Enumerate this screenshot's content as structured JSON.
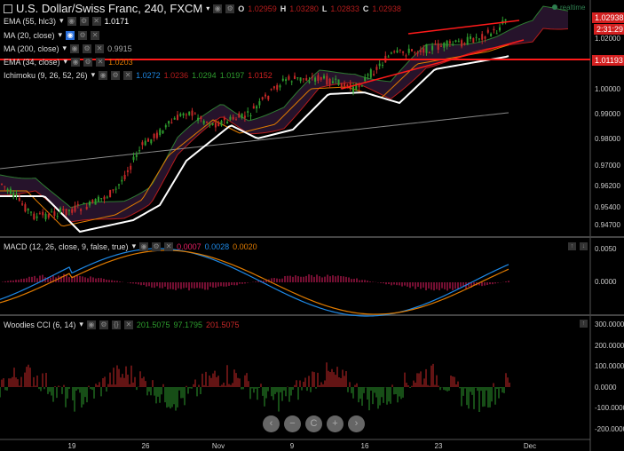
{
  "header": {
    "symbol": "U.S. Dollar/Swiss Franc, 240, FXCM",
    "o_label": "O",
    "o": "1.02959",
    "h_label": "H",
    "h": "1.03280",
    "l_label": "L",
    "l": "1.02833",
    "c_label": "C",
    "c": "1.02938",
    "realtime": "realtime"
  },
  "indicators": [
    {
      "label": "EMA (55, hlc3)",
      "value": "1.0171",
      "color": "#ffffff"
    },
    {
      "label": "MA (20, close)",
      "value": "",
      "color": "#ffffff"
    },
    {
      "label": "MA (200, close)",
      "value": "0.9915",
      "color": "#aaaaaa"
    },
    {
      "label": "EMA (34, close)",
      "value": "1.0203",
      "color": "#e07b00"
    },
    {
      "label": "Ichimoku (9, 26, 52, 26)",
      "values": [
        "1.0272",
        "1.0236",
        "1.0294",
        "1.0197",
        "1.0152"
      ],
      "colors": [
        "#1e88e5",
        "#b71c1c",
        "#2e9d2e",
        "#2e9d2e",
        "#d32020"
      ]
    }
  ],
  "price_axis": [
    "1.02000",
    "1.01000",
    "1.00000",
    "0.99000",
    "0.98000",
    "0.97000",
    "0.96200",
    "0.95400",
    "0.94700"
  ],
  "price_tags": {
    "last": "1.02938",
    "countdown": "2:31:29",
    "line": "1.01193"
  },
  "macd": {
    "label": "MACD (12, 26, close, 9, false, true)",
    "values": [
      "0.0007",
      "0.0028",
      "0.0020"
    ],
    "colors": [
      "#e91e63",
      "#1e88e5",
      "#e07b00"
    ],
    "axis": [
      "0.0050",
      "0.0000"
    ]
  },
  "cci": {
    "label": "Woodies CCI (6, 14)",
    "values": [
      "201.5075",
      "97.1795",
      "201.5075"
    ],
    "colors": [
      "#2e9d2e",
      "#2e9d2e",
      "#c62828"
    ],
    "axis": [
      "300.0000",
      "200.0000",
      "100.0000",
      "0.0000",
      "-100.0000",
      "-200.0000"
    ]
  },
  "time_axis": [
    "19",
    "26",
    "Nov",
    "9",
    "16",
    "23",
    "Dec"
  ],
  "nav": [
    "‹",
    "−",
    "C",
    "+",
    "›"
  ],
  "colors": {
    "up": "#2e9d2e",
    "down": "#c62828",
    "accent": "#d32020"
  }
}
